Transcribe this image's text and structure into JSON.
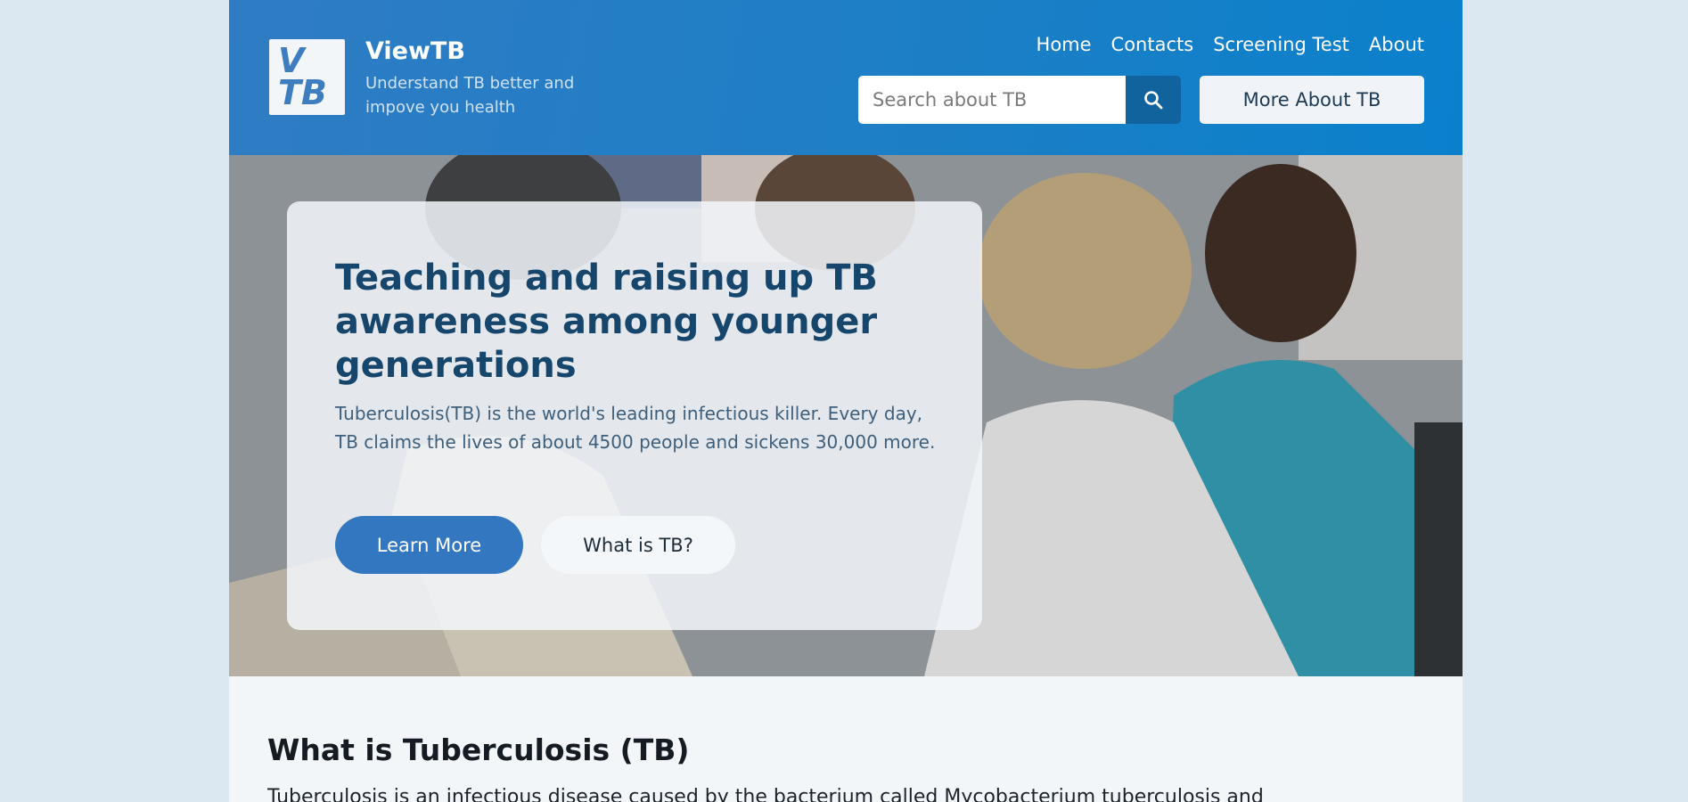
{
  "brand": {
    "logo_line1": "V",
    "logo_line2": "TB",
    "name": "ViewTB",
    "tagline": "Understand TB better and impove you health"
  },
  "nav": {
    "items": [
      {
        "label": "Home"
      },
      {
        "label": "Contacts"
      },
      {
        "label": "Screening Test"
      },
      {
        "label": "About"
      }
    ]
  },
  "search": {
    "placeholder": "Search about TB",
    "value": ""
  },
  "header_button": {
    "label": "More About TB"
  },
  "hero": {
    "title": "Teaching and raising up TB awareness among younger generations",
    "text": "Tuberculosis(TB) is the world's leading infectious killer. Every day, TB claims the lives of about 4500 people and sickens 30,000 more.",
    "primary_button": "Learn More",
    "secondary_button": "What is TB?"
  },
  "section": {
    "title": "What is Tuberculosis (TB)",
    "text": "Tuberculosis is an infectious disease caused by the bacterium called Mycobacterium tuberculosis and"
  },
  "colors": {
    "header_blue": "#2f7cc4",
    "accent": "#3277c0",
    "title_navy": "#17466c"
  }
}
